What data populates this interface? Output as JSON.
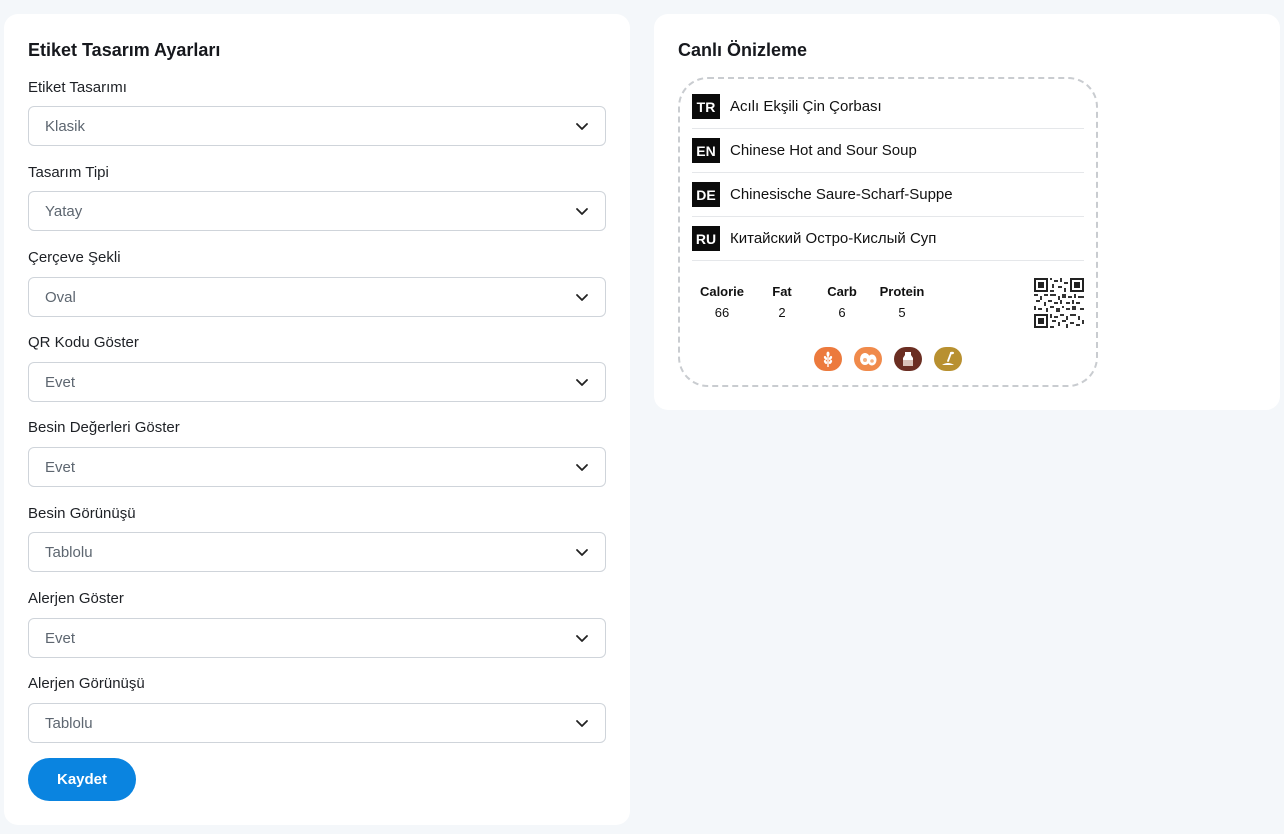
{
  "settings": {
    "title": "Etiket Tasarım Ayarları",
    "fields": [
      {
        "label": "Etiket Tasarımı",
        "value": "Klasik"
      },
      {
        "label": "Tasarım Tipi",
        "value": "Yatay"
      },
      {
        "label": "Çerçeve Şekli",
        "value": "Oval"
      },
      {
        "label": "QR Kodu Göster",
        "value": "Evet"
      },
      {
        "label": "Besin Değerleri Göster",
        "value": "Evet"
      },
      {
        "label": "Besin Görünüşü",
        "value": "Tablolu"
      },
      {
        "label": "Alerjen Göster",
        "value": "Evet"
      },
      {
        "label": "Alerjen Görünüşü",
        "value": "Tablolu"
      }
    ],
    "save_label": "Kaydet"
  },
  "preview": {
    "title": "Canlı Önizleme",
    "languages": [
      {
        "code": "TR",
        "text": "Acılı Ekşili Çin Çorbası"
      },
      {
        "code": "EN",
        "text": "Chinese Hot and Sour Soup"
      },
      {
        "code": "DE",
        "text": "Chinesische Saure-Scharf-Suppe"
      },
      {
        "code": "RU",
        "text": "Китайский Остро-Кислый Суп"
      }
    ],
    "nutrition": [
      {
        "label": "Calorie",
        "value": "66"
      },
      {
        "label": "Fat",
        "value": "2"
      },
      {
        "label": "Carb",
        "value": "6"
      },
      {
        "label": "Protein",
        "value": "5"
      }
    ],
    "allergens": [
      {
        "icon": "wheat-icon",
        "color": "#ec7a3d"
      },
      {
        "icon": "egg-icon",
        "color": "#f08a4b"
      },
      {
        "icon": "milk-icon",
        "color": "#6b2e22"
      },
      {
        "icon": "soy-icon",
        "color": "#b89030"
      }
    ]
  },
  "colors": {
    "accent": "#0a84e0",
    "page_background": "#f4f7fa"
  }
}
